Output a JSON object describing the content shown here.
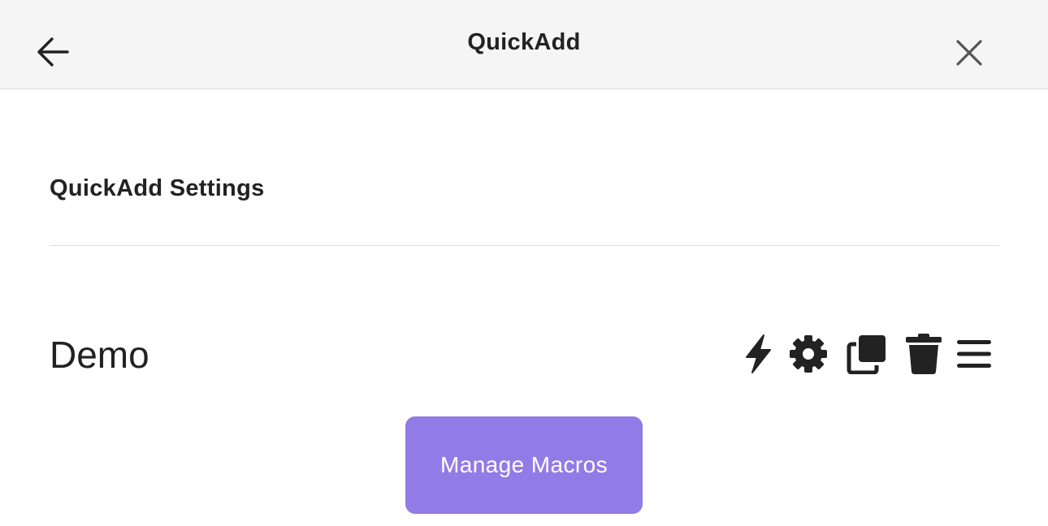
{
  "header": {
    "title": "QuickAdd",
    "back_icon": "arrow-left-icon",
    "close_icon": "close-icon"
  },
  "settings": {
    "section_title": "QuickAdd Settings"
  },
  "choice": {
    "name": "Demo",
    "actions": [
      "lightning-icon",
      "gear-icon",
      "duplicate-icon",
      "trash-icon",
      "drag-handle-icon"
    ]
  },
  "manage_macros": {
    "label": "Manage Macros",
    "color": "#917be6"
  }
}
